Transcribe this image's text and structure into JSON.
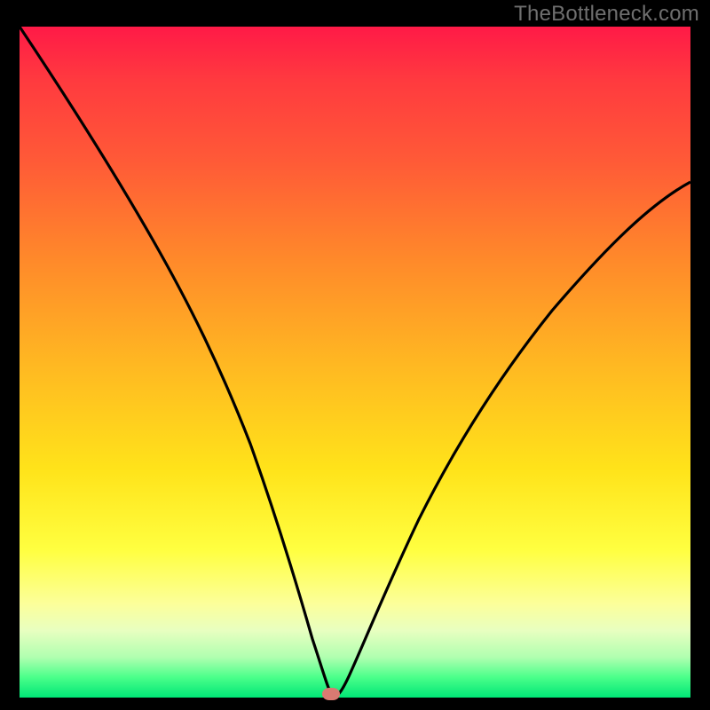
{
  "watermark": "TheBottleneck.com",
  "colors": {
    "gradient_top": "#ff1a47",
    "gradient_mid": "#ffe31a",
    "gradient_bottom": "#00e676",
    "curve": "#000000",
    "dot": "#d97a72",
    "background": "#000000"
  },
  "chart_data": {
    "type": "line",
    "title": "",
    "xlabel": "",
    "ylabel": "",
    "xlim": [
      0,
      100
    ],
    "ylim": [
      0,
      100
    ],
    "series": [
      {
        "name": "bottleneck-curve",
        "x": [
          0,
          5,
          10,
          15,
          20,
          25,
          30,
          35,
          40,
          43,
          45,
          46.5,
          48,
          50,
          54,
          60,
          68,
          76,
          84,
          92,
          100
        ],
        "values": [
          100,
          90,
          80,
          70,
          60,
          50,
          40,
          28,
          16,
          8,
          3,
          0.5,
          2,
          6,
          14,
          26,
          40,
          52,
          62,
          70,
          76
        ]
      }
    ],
    "marker": {
      "x": 46.5,
      "y": 0.5
    },
    "grid": false,
    "legend": false
  }
}
